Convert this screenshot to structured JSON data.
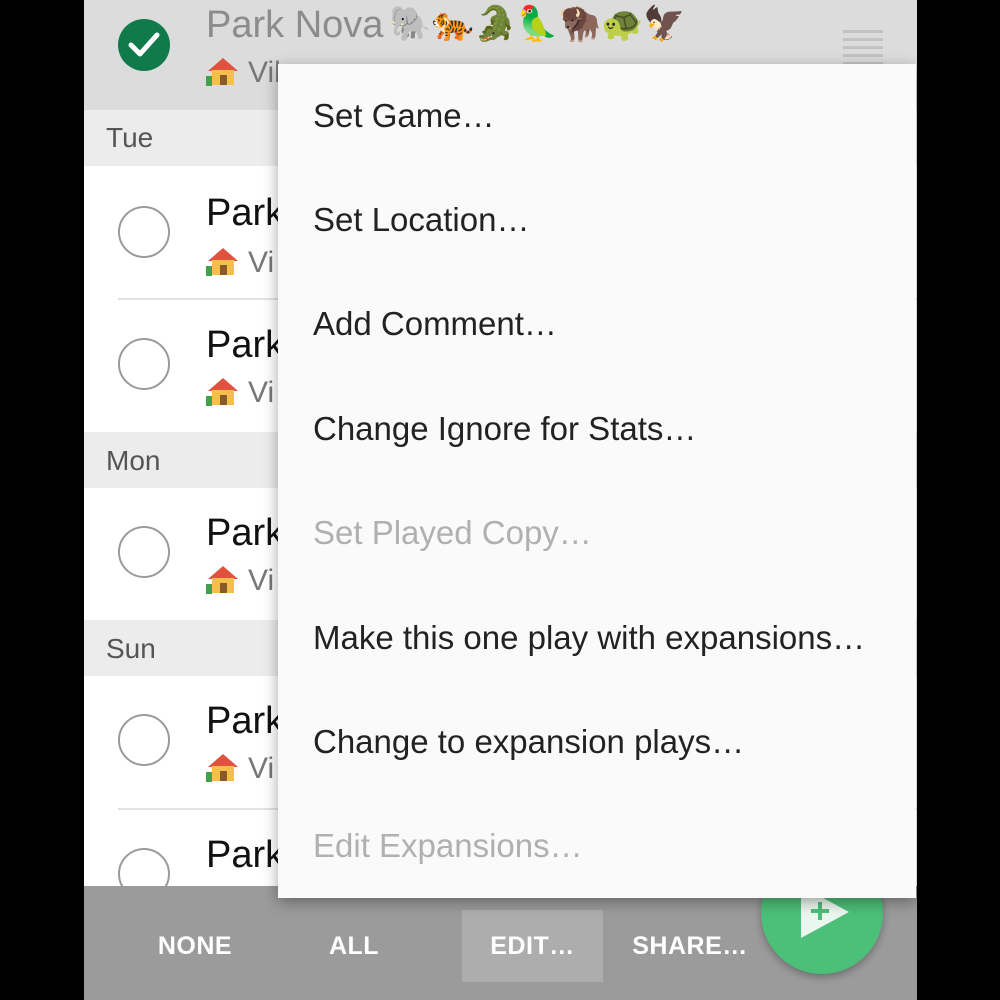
{
  "list": {
    "selected_item": {
      "title": "Park Nova",
      "title_emojis": "🐘🐅🐊🦜🦬🐢🦅",
      "location": "Vil"
    },
    "groups": [
      {
        "header": "Tue",
        "items": [
          {
            "title": "Park",
            "location": "Vi"
          },
          {
            "title": "Park",
            "location": "Vi"
          }
        ]
      },
      {
        "header": "Mon",
        "items": [
          {
            "title": "Park",
            "location": "Vi"
          }
        ]
      },
      {
        "header": "Sun",
        "items": [
          {
            "title": "Park",
            "location": "Vi"
          },
          {
            "title": "Park",
            "location": ""
          }
        ]
      }
    ]
  },
  "menu": {
    "items": [
      {
        "label": "Set Game…",
        "enabled": true
      },
      {
        "label": "Set Location…",
        "enabled": true
      },
      {
        "label": "Add Comment…",
        "enabled": true
      },
      {
        "label": "Change Ignore for Stats…",
        "enabled": true
      },
      {
        "label": "Set Played Copy…",
        "enabled": false
      },
      {
        "label": "Make this one play with expansions…",
        "enabled": true
      },
      {
        "label": "Change to expansion plays…",
        "enabled": true
      },
      {
        "label": "Edit Expansions…",
        "enabled": false
      }
    ]
  },
  "bottom_bar": {
    "none_label": "NONE",
    "all_label": "ALL",
    "edit_label": "EDIT…",
    "share_label": "SHARE…"
  },
  "fab": {
    "icon": "add-play-icon"
  },
  "colors": {
    "check_green": "#107a4a",
    "fab_green": "#4cbf78",
    "bottom_bar": "#9b9b9b",
    "menu_bg": "#fafafa",
    "disabled_text": "#b0b0b0"
  }
}
